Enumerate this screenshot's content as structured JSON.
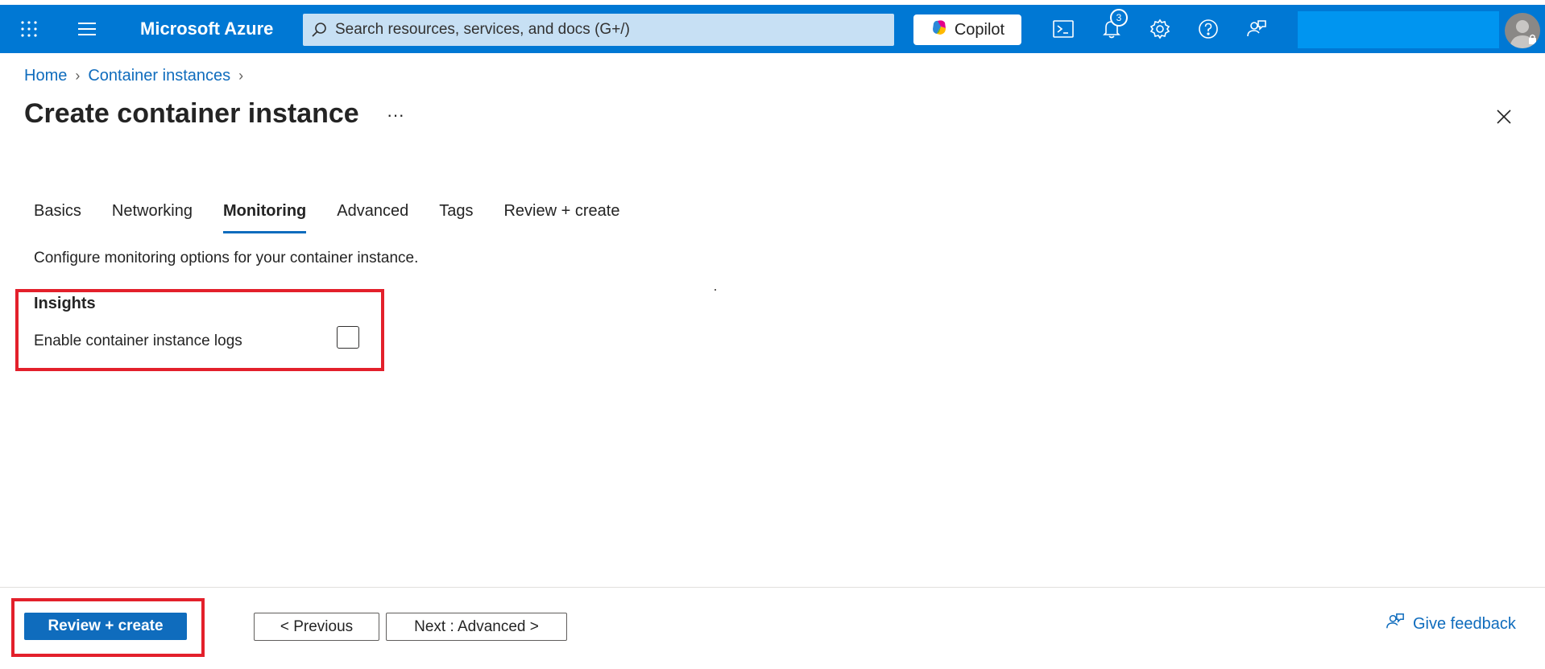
{
  "topbar": {
    "brand": "Microsoft Azure",
    "search_placeholder": "Search resources, services, and docs (G+/)",
    "copilot_label": "Copilot",
    "notification_count": "3",
    "accent_color": "#0078d4"
  },
  "breadcrumb": {
    "items": [
      "Home",
      "Container instances"
    ]
  },
  "page": {
    "title": "Create container instance",
    "more": "···"
  },
  "tabs": [
    {
      "label": "Basics",
      "active": false
    },
    {
      "label": "Networking",
      "active": false
    },
    {
      "label": "Monitoring",
      "active": true
    },
    {
      "label": "Advanced",
      "active": false
    },
    {
      "label": "Tags",
      "active": false
    },
    {
      "label": "Review + create",
      "active": false
    }
  ],
  "monitoring": {
    "description": "Configure monitoring options for your container instance.",
    "insights_heading": "Insights",
    "logs_label": "Enable container instance logs",
    "logs_enabled": false
  },
  "footer": {
    "review_create": "Review + create",
    "previous": "< Previous",
    "next": "Next : Advanced >",
    "feedback": "Give feedback"
  }
}
